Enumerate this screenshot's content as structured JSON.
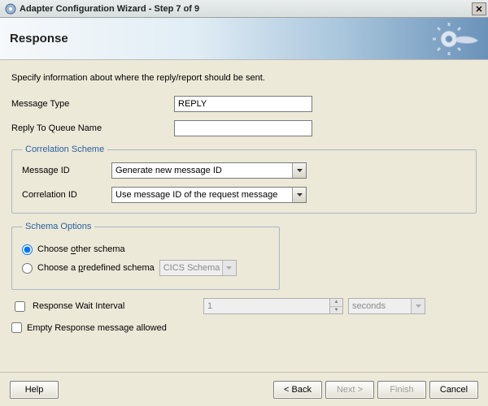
{
  "window": {
    "title": "Adapter Configuration Wizard - Step 7 of 9"
  },
  "banner": {
    "heading": "Response"
  },
  "description": "Specify information about where the reply/report should be sent.",
  "message_type": {
    "label": "Message Type",
    "value": "REPLY"
  },
  "reply_to_queue": {
    "label": "Reply To Queue Name",
    "value": ""
  },
  "correlation": {
    "legend": "Correlation Scheme",
    "message_id_label": "Message ID",
    "message_id_value": "Generate new message ID",
    "correlation_id_label": "Correlation ID",
    "correlation_id_value": "Use message ID of the request message"
  },
  "schema": {
    "legend": "Schema Options",
    "choose_other_prefix": "Choose ",
    "choose_other_u": "o",
    "choose_other_suffix": "ther schema",
    "choose_predef_prefix": "Choose a ",
    "choose_predef_u": "p",
    "choose_predef_suffix": "redefined schema",
    "predef_combo": "CICS Schema",
    "selected": "other"
  },
  "wait": {
    "label": "Response Wait Interval",
    "value": "1",
    "unit": "seconds"
  },
  "empty_resp": {
    "label": "Empty Response message allowed"
  },
  "buttons": {
    "help": "Help",
    "back": "< Back",
    "next": "Next >",
    "finish": "Finish",
    "cancel": "Cancel"
  }
}
